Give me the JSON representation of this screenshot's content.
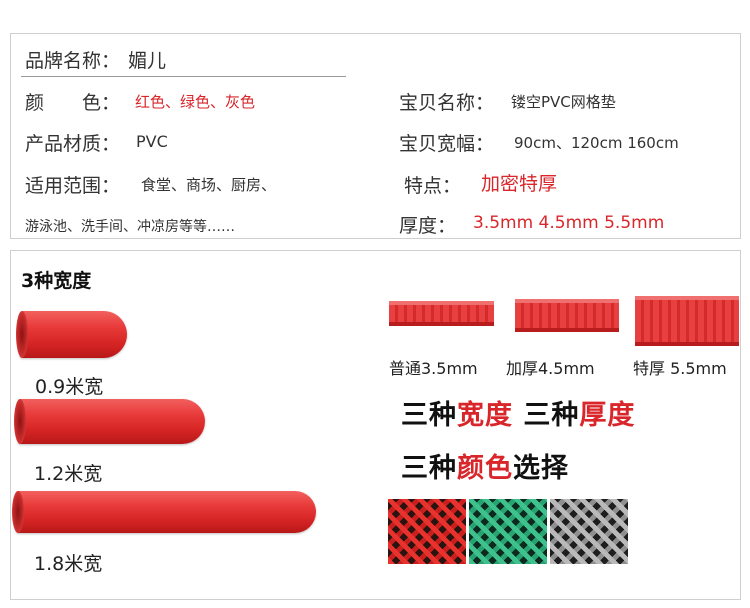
{
  "specs": {
    "brand_label": "品牌名称：",
    "brand_value": "媚儿",
    "color_label": "颜　　色：",
    "color_value": "红色、绿色、灰色",
    "name_label": "宝贝名称：",
    "name_value": "镂空PVC网格垫",
    "material_label": "产品材质：",
    "material_value": "PVC",
    "width_label": "宝贝宽幅：",
    "width_value": "90cm、120cm 160cm",
    "usage_label": "适用范围：",
    "usage_value": "食堂、商场、厨房、",
    "usage_value_2": "游泳池、洗手间、冲凉房等等……",
    "feature_label": "特点：",
    "feature_value": "加密特厚",
    "thickness_label": "厚度：",
    "thickness_value": "3.5mm  4.5mm  5.5mm"
  },
  "widths": {
    "heading": "3种宽度",
    "items": [
      "0.9米宽",
      "1.2米宽",
      "1.8米宽"
    ]
  },
  "thicknesses": {
    "items": [
      "普通3.5mm",
      "加厚4.5mm",
      "特厚 5.5mm"
    ]
  },
  "slogans": {
    "line1_a": "三种",
    "line1_b": "宽度",
    "line1_c": " 三种",
    "line1_d": "厚度",
    "line2_a": "三种",
    "line2_b": "颜色",
    "line2_c": "选择"
  },
  "colors": {
    "accent_red": "#d9262b",
    "swatches": [
      "red",
      "green",
      "gray"
    ]
  }
}
